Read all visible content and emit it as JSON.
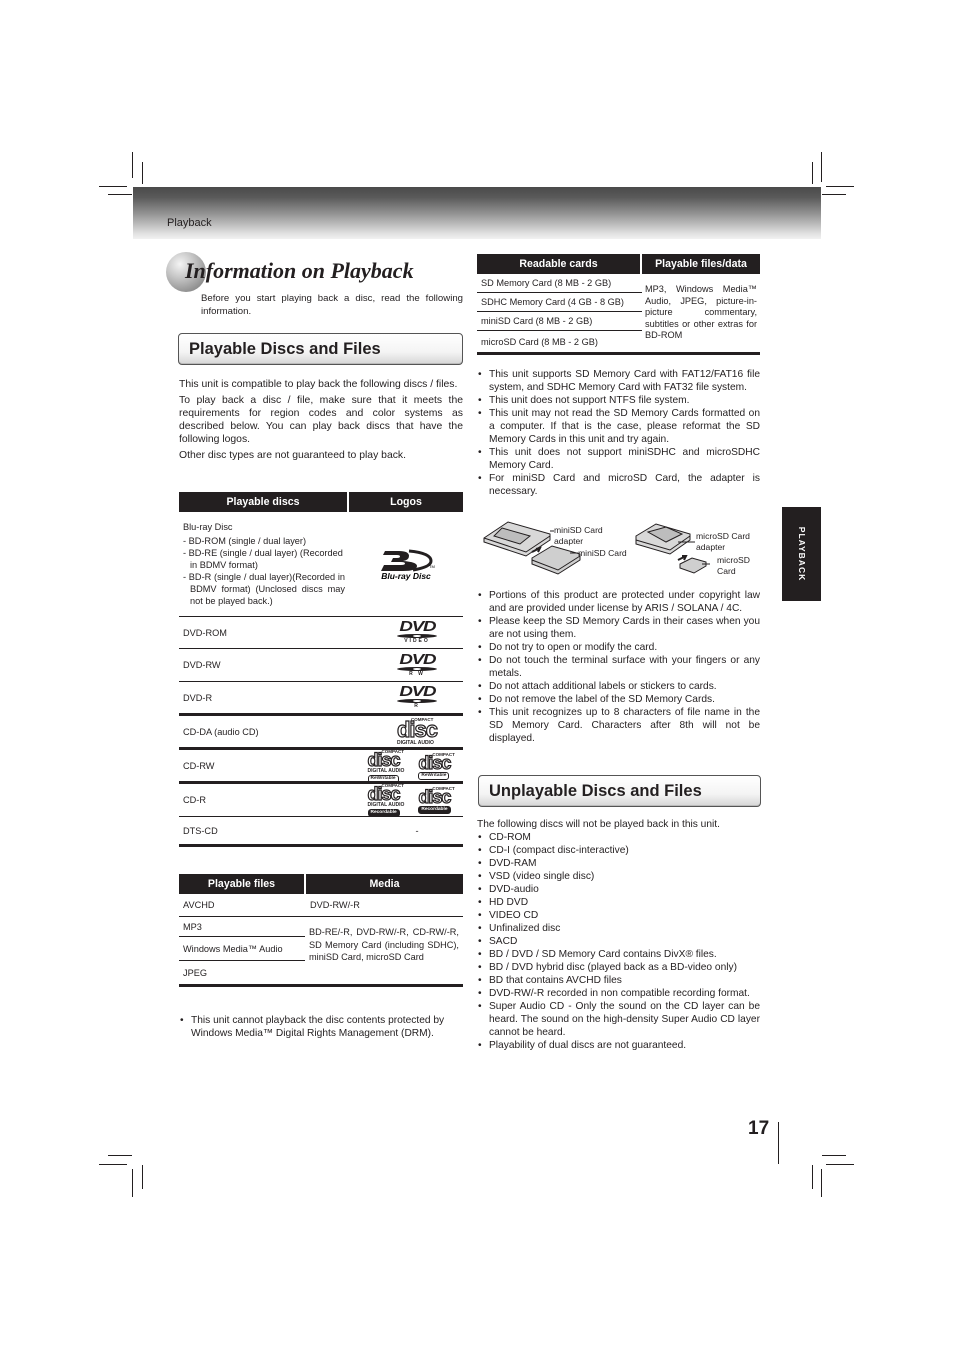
{
  "header": {
    "section_label": "Playback"
  },
  "title": "Information on Playback",
  "intro": "Before you start playing back a disc, read the following information.",
  "section_playable": {
    "heading": "Playable Discs and Files",
    "paragraphs": [
      "This unit is compatible to play back the following discs / files.",
      "To play back a disc / file, make sure that it meets the requirements for region codes and color systems as described below. You can play back discs that have the following logos.",
      "Other disc types are not guaranteed to play back."
    ]
  },
  "discs_table": {
    "headers": [
      "Playable discs",
      "Logos"
    ],
    "bluray": {
      "title": "Blu-ray Disc",
      "items": [
        "- BD-ROM (single / dual layer)",
        "- BD-RE (single / dual layer) (Recorded in BDMV format)",
        "- BD-R (single / dual layer)(Recorded in BDMV format) (Unclosed discs may not be played back.)"
      ],
      "logo": "blu-ray-disc-logo",
      "logo_text": "Blu-ray Disc",
      "tm": "TM"
    },
    "rows": [
      {
        "name": "DVD-ROM",
        "logo": "dvd-video-logo",
        "logo_sub": "VIDEO"
      },
      {
        "name": "DVD-RW",
        "logo": "dvd-rw-logo",
        "logo_sub": "R W"
      },
      {
        "name": "DVD-R",
        "logo": "dvd-r-logo",
        "logo_sub": "R"
      },
      {
        "name": "CD-DA (audio CD)",
        "logo": "compact-disc-digital-audio-logo"
      },
      {
        "name": "CD-RW",
        "logo": "compact-disc-rewritable-logos"
      },
      {
        "name": "CD-R",
        "logo": "compact-disc-recordable-logos"
      },
      {
        "name": "DTS-CD",
        "logo_text": "-"
      }
    ],
    "logo_words": {
      "dvd": "DVD",
      "compact": "COMPACT",
      "disc": "disc",
      "digital_audio": "DIGITAL AUDIO",
      "rewritable": "ReWritable",
      "recordable": "Recordable"
    }
  },
  "files_table": {
    "headers": [
      "Playable files",
      "Media"
    ],
    "rows": [
      {
        "file": "AVCHD",
        "media": "DVD-RW/-R"
      },
      {
        "file": "MP3"
      },
      {
        "file": "Windows Media™ Audio"
      },
      {
        "file": "JPEG"
      }
    ],
    "shared_media": "BD-RE/-R, DVD-RW/-R, CD-RW/-R, SD Memory Card (including SDHC), miniSD Card, microSD Card"
  },
  "drm_note": "This unit cannot playback the disc contents protected by Windows Media™ Digital Rights Management (DRM).",
  "cards_table": {
    "headers": [
      "Readable cards",
      "Playable files/data"
    ],
    "rows": [
      "SD Memory Card (8 MB - 2 GB)",
      "SDHC Memory Card (4 GB - 8 GB)",
      "miniSD Card (8 MB - 2 GB)",
      "microSD Card (8 MB - 2 GB)"
    ],
    "playable": "MP3, Windows Media™ Audio, JPEG, picture-in-picture commentary, subtitles or other extras for BD-ROM"
  },
  "card_notes": [
    "This unit supports SD Memory Card with FAT12/FAT16 file system, and SDHC Memory Card with FAT32 file system.",
    "This unit does not support NTFS file system.",
    "This unit may not read the SD Memory Cards formatted on a computer. If that is the case, please reformat the SD Memory Cards in this unit and try again.",
    "This unit does not support miniSDHC and microSDHC Memory Card.",
    "For miniSD Card and microSD Card, the adapter is necessary."
  ],
  "card_figure": {
    "labels": [
      "miniSD Card adapter",
      "miniSD Card",
      "microSD Card adapter",
      "microSD Card"
    ]
  },
  "card_notes_2": [
    "Portions of this product are protected under copyright law and are provided under license by ARIS / SOLANA / 4C.",
    "Please keep the SD Memory Cards in their cases when you are not using them.",
    "Do not try to open or modify the card.",
    "Do not touch the terminal surface with your fingers or any metals.",
    "Do not attach additional labels or stickers to cards.",
    "Do not remove the label of the SD Memory Cards.",
    "This unit recognizes up to 8 characters of file name in the SD Memory Card. Characters after 8th will not be displayed."
  ],
  "section_unplayable": {
    "heading": "Unplayable Discs and Files",
    "intro": "The following discs will not be played back in this unit.",
    "items": [
      "CD-ROM",
      "CD-I (compact disc-interactive)",
      "DVD-RAM",
      "VSD (video single disc)",
      "DVD-audio",
      "HD DVD",
      "VIDEO CD",
      "Unfinalized disc",
      "SACD",
      "BD / DVD / SD Memory Card contains DivX® files.",
      "BD / DVD hybrid disc (played back as a BD-video only)",
      "BD that contains AVCHD files",
      "DVD-RW/-R recorded in non compatible recording format.",
      "Super Audio CD - Only the sound on the CD layer can be heard. The sound on the high-density Super Audio CD layer cannot be heard.",
      "Playability of dual discs are not guaranteed."
    ]
  },
  "side_tab": "PLAYBACK",
  "page_number": "17"
}
